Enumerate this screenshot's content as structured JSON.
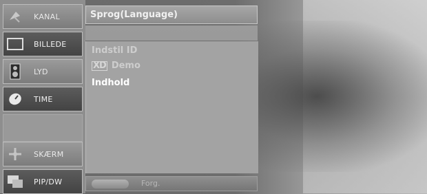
{
  "sidebar": {
    "items": [
      {
        "label": "KANAL",
        "icon": "satellite-dish-icon"
      },
      {
        "label": "BILLEDE",
        "icon": "screen-icon"
      },
      {
        "label": "LYD",
        "icon": "speaker-icon"
      },
      {
        "label": "TIME",
        "icon": "clock-icon"
      },
      {
        "label": "SKÆRM",
        "icon": "screen-adjust-icon"
      },
      {
        "label": "PIP/DW",
        "icon": "pip-icon"
      }
    ]
  },
  "menu": {
    "title": "Sprog(Language)",
    "options": [
      {
        "label": "Indstil ID",
        "state": "dimmed"
      },
      {
        "label": "Demo",
        "prefix_logo": "XD",
        "state": "dimmed"
      },
      {
        "label": "Indhold",
        "state": "highlighted"
      }
    ]
  },
  "footer": {
    "label": "Forg."
  }
}
